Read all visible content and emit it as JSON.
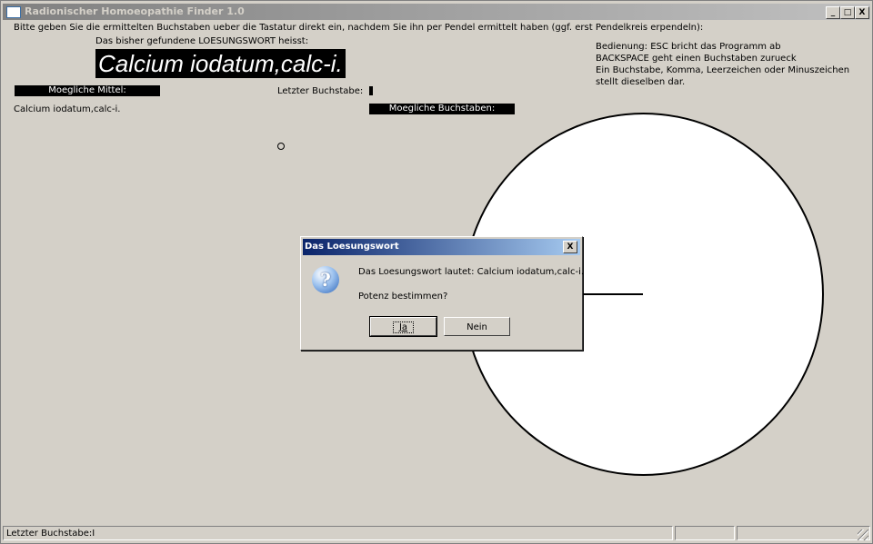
{
  "window": {
    "title": "Radionischer Homoeopathie Finder 1.0",
    "controls": {
      "minimize": "_",
      "maximize": "□",
      "close": "X"
    }
  },
  "main": {
    "instruction": "Bitte geben Sie die ermittelten Buchstaben ueber die Tastatur direkt ein, nachdem Sie ihn per Pendel ermittelt haben (ggf. erst Pendelkreis erpendeln):",
    "found_label": "Das bisher gefundene LOESUNGSWORT heisst:",
    "solution_word": "Calcium iodatum,calc-i.",
    "mittel_header": "Moegliche Mittel:",
    "mittel_items": [
      "Calcium iodatum,calc-i."
    ],
    "last_letter_label": "Letzter Buchstabe:",
    "last_letter_value": "I",
    "buchstaben_header": "Moegliche Buchstaben:",
    "help_lines": [
      "Bedienung: ESC bricht das Programm ab",
      "BACKSPACE geht einen Buchstaben zurueck",
      "Ein Buchstabe, Komma, Leerzeichen oder Minuszeichen",
      "stellt dieselben dar."
    ],
    "small_circle": "o"
  },
  "dialog": {
    "title": "Das Loesungswort",
    "close": "X",
    "icon": "question-icon",
    "icon_glyph": "?",
    "message": "Das Loesungswort lautet: Calcium iodatum,calc-i.",
    "question": "Potenz bestimmen?",
    "yes_label": "Ja",
    "no_label": "Nein"
  },
  "statusbar": {
    "text": "Letzter Buchstabe:I"
  }
}
